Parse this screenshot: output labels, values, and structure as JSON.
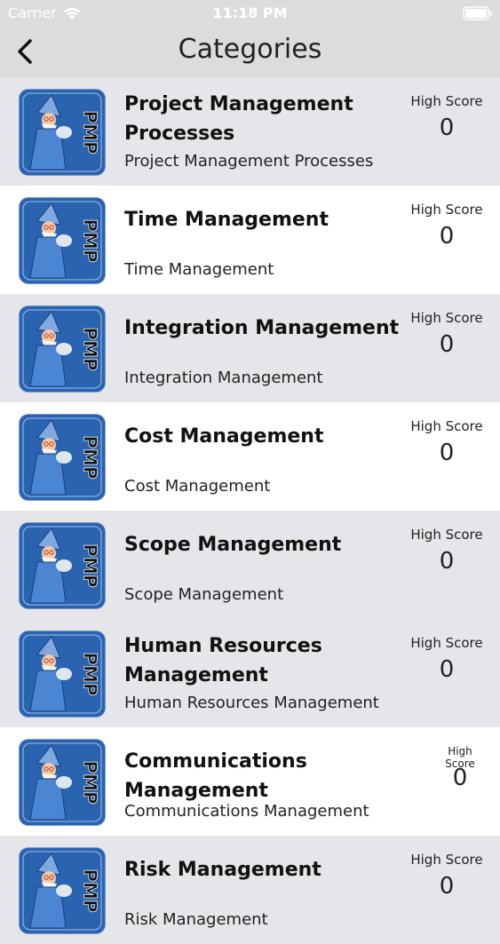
{
  "status_bar": {
    "carrier": "Carrier",
    "time": "11:18 PM"
  },
  "nav": {
    "title": "Categories",
    "back_icon": "chevron-left-icon"
  },
  "score_label": "High Score",
  "categories": [
    {
      "title": "Project Management Processes",
      "subtitle": "Project Management Processes",
      "score": "0"
    },
    {
      "title": "Time Management",
      "subtitle": "Time Management",
      "score": "0"
    },
    {
      "title": "Integration Management",
      "subtitle": "Integration Management",
      "score": "0"
    },
    {
      "title": "Cost Management",
      "subtitle": "Cost Management",
      "score": "0"
    },
    {
      "title": "Scope Management",
      "subtitle": "Scope Management",
      "score": "0"
    },
    {
      "title": "Human Resources Management",
      "subtitle": "Human Resources Management",
      "score": "0"
    },
    {
      "title": "Communications Management",
      "subtitle": "Communications Management",
      "score": "0"
    },
    {
      "title": "Risk Management",
      "subtitle": "Risk Management",
      "score": "0"
    }
  ],
  "thumbnail": {
    "text": "PMP",
    "icon": "wizard-pmp-icon"
  },
  "colors": {
    "header": "#dcdcdc",
    "row_grey": "#e6e6ea",
    "row_white": "#ffffff",
    "thumb_blue": "#2a64b0"
  }
}
